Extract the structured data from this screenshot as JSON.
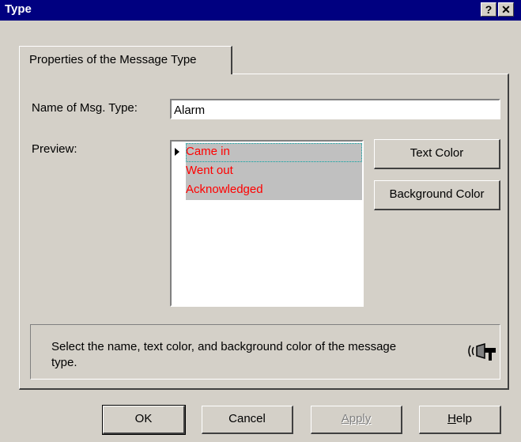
{
  "window": {
    "title": "Type",
    "help_button": "?",
    "close_button": "✕"
  },
  "tab": {
    "label": "Properties of the Message Type"
  },
  "name_field": {
    "label": "Name of Msg. Type:",
    "value": "Alarm"
  },
  "preview": {
    "label": "Preview:",
    "items": [
      "Came in",
      "Went out",
      "Acknowledged"
    ],
    "text_color": "#ff0000",
    "background_color": "#c0c0c0"
  },
  "side_buttons": {
    "text_color": "Text Color",
    "background_color": "Background Color"
  },
  "info": {
    "text": "Select the name, text color, and background color of the message type.",
    "icon": "megaphone-icon"
  },
  "footer": {
    "ok": "OK",
    "cancel": "Cancel",
    "apply": "Apply",
    "help": "Help"
  }
}
